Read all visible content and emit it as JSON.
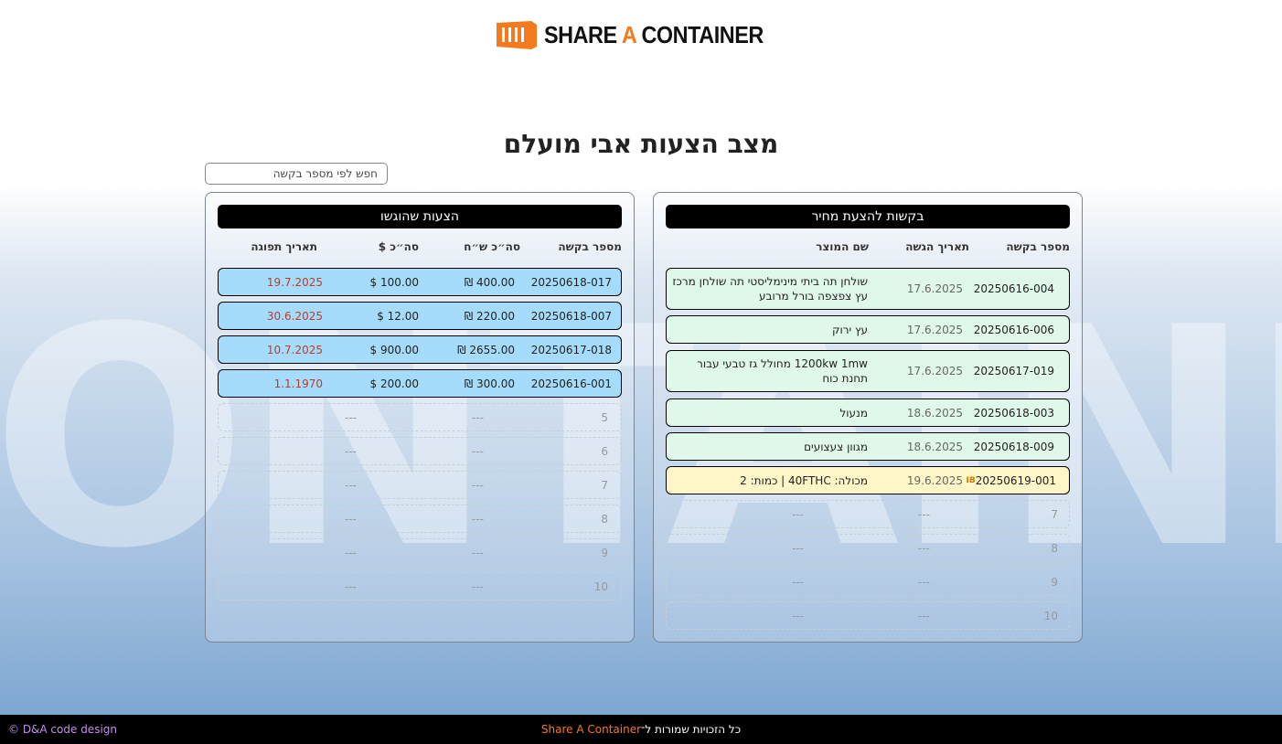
{
  "logo": {
    "part1": "SHARE ",
    "accent": "A",
    "part2": " CONTAINER"
  },
  "watermark": "ONTAINE",
  "page_title": "מצב הצעות אבי מועלם",
  "search": {
    "placeholder": "חפש לפי מספר בקשה",
    "value": ""
  },
  "right_panel": {
    "title": "בקשות להצעת מחיר",
    "columns": {
      "id": "מספר בקשה",
      "date": "תאריך הגשה",
      "product": "שם המוצר"
    },
    "rows": [
      {
        "id": "20250616-004",
        "date": "17.6.2025",
        "product": "שולחן תה ביתי מינימליסטי תה שולחן מרכז עץ צפצפה בורל מרובע"
      },
      {
        "id": "20250616-006",
        "date": "17.6.2025",
        "product": "עץ ירוק"
      },
      {
        "id": "20250617-019",
        "date": "17.6.2025",
        "product": "1200kw 1mw מחולל גז טבעי עבור תחנת כוח"
      },
      {
        "id": "20250618-003",
        "date": "18.6.2025",
        "product": "מנעול"
      },
      {
        "id": "20250618-009",
        "date": "18.6.2025",
        "product": "מגוון צעצועים"
      },
      {
        "id": "20250619-001",
        "tag": "IB",
        "date": "19.6.2025",
        "product": "מכולה: 40FTHC | כמות: 2"
      }
    ],
    "empty_rows": [
      {
        "num": "7",
        "date": "---",
        "product": "---"
      },
      {
        "num": "8",
        "date": "---",
        "product": "---"
      },
      {
        "num": "9",
        "date": "---",
        "product": "---"
      },
      {
        "num": "10",
        "date": "---",
        "product": "---"
      }
    ]
  },
  "left_panel": {
    "title": "הצעות שהוגשו",
    "columns": {
      "id": "מספר בקשה",
      "ils": "סה״כ ש״ח",
      "usd": "סה״כ $",
      "delivery": "תאריך תפוגה"
    },
    "rows": [
      {
        "id": "20250618-017",
        "ils": "400.00 ₪",
        "usd": "100.00 $",
        "delivery": "19.7.2025"
      },
      {
        "id": "20250618-007",
        "ils": "220.00 ₪",
        "usd": "12.00 $",
        "delivery": "30.6.2025"
      },
      {
        "id": "20250617-018",
        "ils": "2655.00 ₪",
        "usd": "900.00 $",
        "delivery": "10.7.2025"
      },
      {
        "id": "20250616-001",
        "ils": "300.00 ₪",
        "usd": "200.00 $",
        "delivery": "1.1.1970"
      }
    ],
    "empty_rows": [
      {
        "num": "5",
        "ils": "---",
        "usd": "---"
      },
      {
        "num": "6",
        "ils": "---",
        "usd": "---"
      },
      {
        "num": "7",
        "ils": "---",
        "usd": "---"
      },
      {
        "num": "8",
        "ils": "---",
        "usd": "---"
      },
      {
        "num": "9",
        "ils": "---",
        "usd": "---"
      },
      {
        "num": "10",
        "ils": "---",
        "usd": "---"
      }
    ]
  },
  "footer": {
    "rights": "כל הזכויות שמורות ל־",
    "brand": "Share A Container",
    "credit": "© D&A code design"
  },
  "colors": {
    "brand_orange": "#f47a20",
    "sent_row": "#a5dcfb",
    "request_row": "#e0f8ea",
    "ib_row": "#fff6c7",
    "expiry_red": "#c0392b"
  }
}
